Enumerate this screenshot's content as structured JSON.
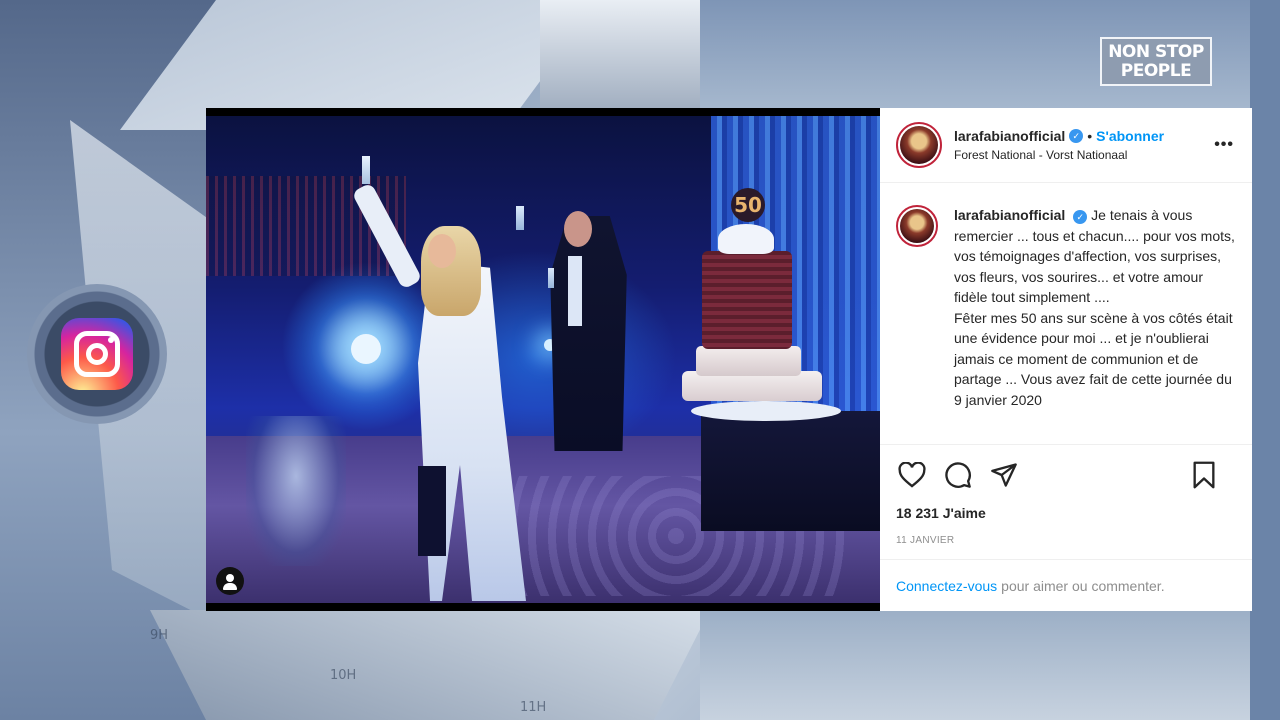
{
  "brand": {
    "line1": "NON STOP",
    "line2": "PEOPLE"
  },
  "background_clock": [
    "9H",
    "10H",
    "11H"
  ],
  "post": {
    "username": "larafabianofficial",
    "verified_icon": "verified-check",
    "follow_separator": "•",
    "follow_label": "S'abonner",
    "location": "Forest National - Vorst Nationaal",
    "more_icon": "•••",
    "media": {
      "cake_number": "50"
    },
    "caption": {
      "username": "larafabianofficial",
      "paragraph1": "Je tenais à vous remercier ... tous et chacun.... pour vos mots, vos témoignages d'affection, vos surprises, vos fleurs, vos sourires... et votre amour fidèle tout simplement ....",
      "paragraph2": "Fêter mes 50 ans sur scène à vos côtés était une évidence pour moi ... et je n'oublierai jamais ce moment de communion et de partage ... Vous avez fait de cette journée du 9 janvier 2020"
    },
    "actions": {
      "like_icon": "heart-icon",
      "comment_icon": "comment-icon",
      "share_icon": "share-icon",
      "save_icon": "bookmark-icon"
    },
    "likes": "18 231 J'aime",
    "date": "11 JANVIER",
    "login_link": "Connectez-vous",
    "login_text": "pour aimer ou commenter."
  },
  "colors": {
    "link": "#0095f6",
    "verified": "#3897f0",
    "text": "#262626",
    "muted": "#8e8e8e"
  }
}
